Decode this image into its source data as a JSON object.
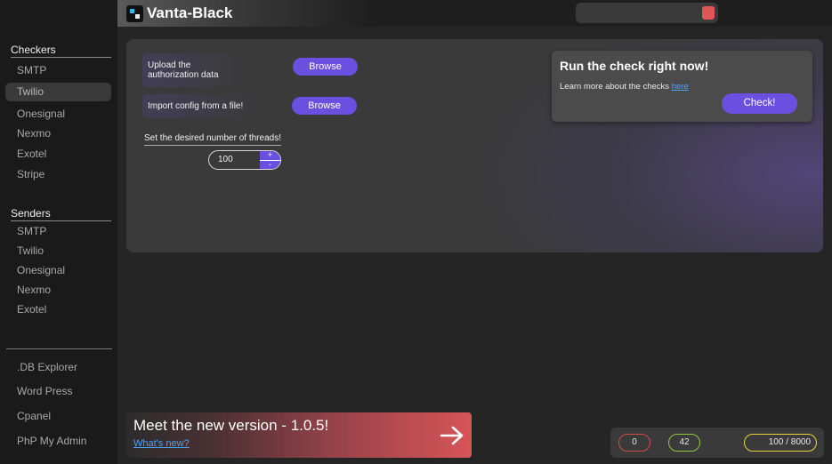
{
  "app": {
    "title": "Vanta-Black"
  },
  "colors": {
    "accent": "#6a50e0",
    "close": "#e05555",
    "link": "#4aa3ff",
    "error": "#d04a4a",
    "ok": "#8ec63f",
    "progress": "#e6d43a"
  },
  "sidebar": {
    "checkers_title": "Checkers",
    "checkers": [
      {
        "label": "SMTP"
      },
      {
        "label": "Twilio",
        "active": true
      },
      {
        "label": "Onesignal"
      },
      {
        "label": "Nexmo"
      },
      {
        "label": "Exotel"
      },
      {
        "label": "Stripe"
      }
    ],
    "senders_title": "Senders",
    "senders": [
      {
        "label": "SMTP"
      },
      {
        "label": "Twilio"
      },
      {
        "label": "Onesignal"
      },
      {
        "label": "Nexmo"
      },
      {
        "label": "Exotel"
      }
    ],
    "tools": [
      {
        "label": ".DB Explorer"
      },
      {
        "label": "Word Press"
      },
      {
        "label": "Cpanel"
      },
      {
        "label": "PhP My Admin"
      }
    ]
  },
  "main": {
    "auth_label": "Upload the authorization data",
    "auth_button": "Browse",
    "config_label": "Import config from a file!",
    "config_button": "Browse",
    "threads_label": "Set the desired number of threads!",
    "threads_value": "100",
    "plus": "+",
    "minus": "-"
  },
  "check_card": {
    "title": "Run the check right now!",
    "text": "Learn more about the checks ",
    "link": "here",
    "button": "Check!"
  },
  "promo": {
    "title": "Meet the new version - 1.0.5!",
    "link": "What's new?",
    "arrow_icon": "arrow-right-icon"
  },
  "status": {
    "errors": "0",
    "valid": "42",
    "progress": "100 / 8000"
  }
}
